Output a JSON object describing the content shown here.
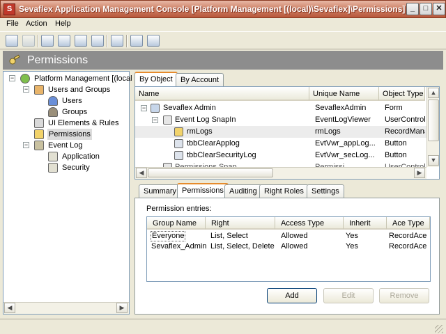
{
  "window": {
    "app_icon_letter": "S",
    "title": "Sevaflex Application Management Console [Platform Management [(local)\\Sevaflex]\\Permissions]",
    "minimize": "_",
    "maximize": "□",
    "close": "✕"
  },
  "menu": {
    "file": "File",
    "action": "Action",
    "help": "Help"
  },
  "section": {
    "title": "Permissions"
  },
  "tree": {
    "root": "Platform Management [(local",
    "users_groups": "Users and Groups",
    "users": "Users",
    "groups": "Groups",
    "ui_elements": "UI Elements & Rules",
    "permissions": "Permissions",
    "event_log": "Event Log",
    "application": "Application",
    "security": "Security"
  },
  "view_tabs": {
    "by_object": "By Object",
    "by_account": "By Account"
  },
  "grid": {
    "headers": {
      "name": "Name",
      "unique": "Unique Name",
      "type": "Object Type"
    },
    "rows": [
      {
        "name": "Sevaflex Admin",
        "unique": "SevaflexAdmin",
        "type": "Form"
      },
      {
        "name": "Event Log SnapIn",
        "unique": "EventLogViewer",
        "type": "UserControl"
      },
      {
        "name": "rmLogs",
        "unique": "rmLogs",
        "type": "RecordMana"
      },
      {
        "name": "tbbClearApplog",
        "unique": "EvtVwr_appLog...",
        "type": "Button"
      },
      {
        "name": "tbbClearSecurityLog",
        "unique": "EvtVwr_secLog...",
        "type": "Button"
      },
      {
        "name": "Permissions Snap...",
        "unique": "Permissi...",
        "type": "UserControl"
      }
    ]
  },
  "detail_tabs": {
    "summary": "Summary",
    "permissions": "Permissions",
    "auditing": "Auditing",
    "right_roles": "Right Roles",
    "settings": "Settings"
  },
  "permission_entries": {
    "label": "Permission entries:",
    "headers": {
      "group": "Group Name",
      "right": "Right",
      "access": "Access Type",
      "inherit": "Inherit",
      "ace": "Ace Type"
    },
    "rows": [
      {
        "group": "Everyone",
        "right": "List, Select",
        "access": "Allowed",
        "inherit": "Yes",
        "ace": "RecordAce"
      },
      {
        "group": "Sevaflex_Admin",
        "right": "List, Select, Delete",
        "access": "Allowed",
        "inherit": "Yes",
        "ace": "RecordAce"
      }
    ]
  },
  "buttons": {
    "add": "Add",
    "edit": "Edit",
    "remove": "Remove"
  },
  "icons": {
    "tb1": "back-icon",
    "tb2": "save-icon",
    "tb3": "properties-icon",
    "tb4": "refresh-icon",
    "tb5": "connect-icon",
    "tb6": "help-icon",
    "tb7": "snapin-icon",
    "tb8": "window-new-icon",
    "tb9": "window-split-icon"
  },
  "colors": {
    "title_bar": "#c85c3c",
    "section_header": "#8d8d8d",
    "tab_accent": "#e68b2c",
    "selection": "#dcdcdc"
  }
}
